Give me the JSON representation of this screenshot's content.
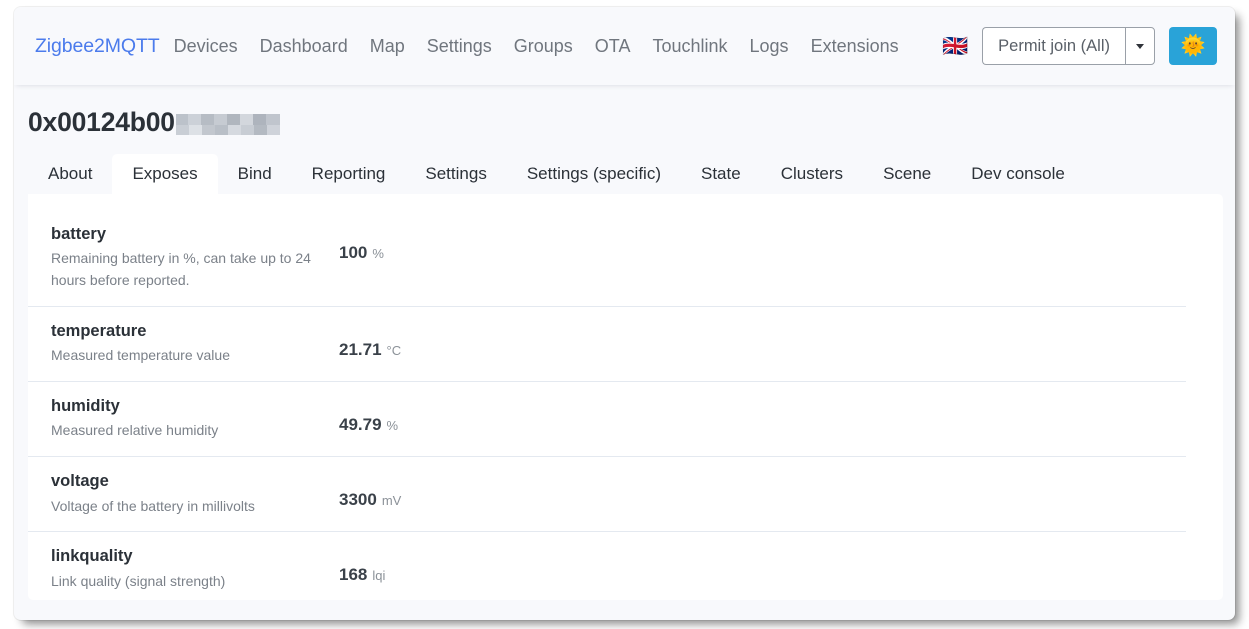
{
  "navbar": {
    "brand": "Zigbee2MQTT",
    "links": [
      "Devices",
      "Dashboard",
      "Map",
      "Settings",
      "Groups",
      "OTA",
      "Touchlink",
      "Logs",
      "Extensions"
    ],
    "flag_icon": "🇬🇧",
    "permit_join_label": "Permit join (All)",
    "caret_icon": "chevron-down-icon",
    "theme_icon": "🌞",
    "theme_button_color": "#29a3d8",
    "brand_color": "#4b7bec"
  },
  "page": {
    "title_prefix": "0x00124b00",
    "title_redacted": true
  },
  "tabs": {
    "items": [
      "About",
      "Exposes",
      "Bind",
      "Reporting",
      "Settings",
      "Settings (specific)",
      "State",
      "Clusters",
      "Scene",
      "Dev console"
    ],
    "active": "Exposes"
  },
  "exposes": [
    {
      "name": "battery",
      "description": "Remaining battery in %, can take up to 24 hours before reported.",
      "value": "100",
      "unit": "%"
    },
    {
      "name": "temperature",
      "description": "Measured temperature value",
      "value": "21.71",
      "unit": "°C"
    },
    {
      "name": "humidity",
      "description": "Measured relative humidity",
      "value": "49.79",
      "unit": "%"
    },
    {
      "name": "voltage",
      "description": "Voltage of the battery in millivolts",
      "value": "3300",
      "unit": "mV"
    },
    {
      "name": "linkquality",
      "description": "Link quality (signal strength)",
      "value": "168",
      "unit": "lqi"
    }
  ]
}
